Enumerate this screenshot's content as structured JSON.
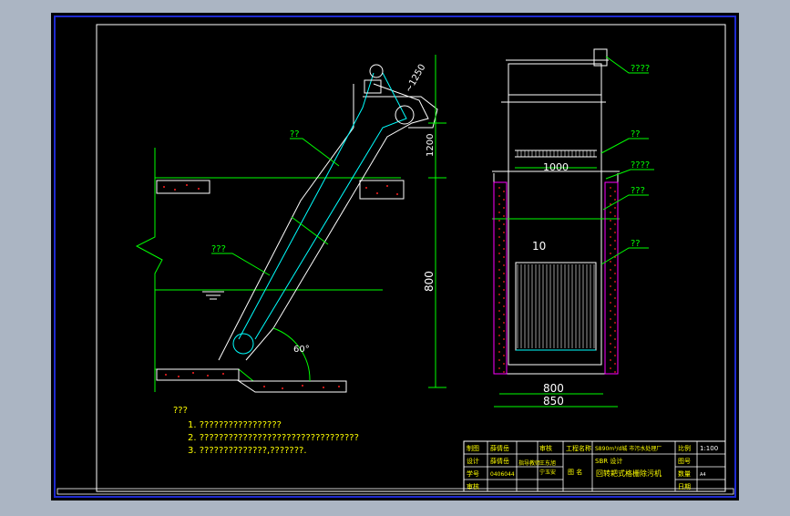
{
  "colors": {
    "background": "#abb5c3",
    "paper": "#000000",
    "line_white": "#ffffff",
    "line_green": "#00ff00",
    "line_cyan": "#00ffff",
    "line_yellow": "#ffff00",
    "line_red": "#ff2020",
    "line_magenta": "#ff00ff",
    "border_blue": "#1e2ad0"
  },
  "dimensions": {
    "d1250": "~1250",
    "d1200": "1200",
    "d800_vertical": "800",
    "d1000": "1000",
    "d10": "10",
    "d800_bottom": "800",
    "d850": "850",
    "angle": "60°"
  },
  "callouts": {
    "c_left_top": "??",
    "c_left_mid": "???",
    "c_right_1": "????",
    "c_right_2": "??",
    "c_right_3": "????",
    "c_right_4": "???",
    "c_right_5": "??"
  },
  "notes": {
    "title": "???",
    "line1": "1. ?????????????????",
    "line2": "2. ?????????????????????????????????",
    "line3": "3. ??????????????,???????."
  },
  "title_block": {
    "r1c1": "制图",
    "r1c2": "薛倩岳",
    "r1c3": "审核",
    "r1c4": "工程名称",
    "r1c5": "S890m³/d城 市污水处理厂",
    "r1c6": "比例",
    "r1c7": "1:100",
    "r2c1": "设计",
    "r2c2": "薛倩岳",
    "r2c3": "指导教师",
    "r2c4": "王东旭",
    "r2c5": "SBR 设计",
    "r2c6": "图号",
    "r3c1": "学号",
    "r3c2": "0406044",
    "r3c3": "",
    "r3c4": "宁玉安",
    "r3c5": "图 名",
    "r3c6": "回转耙式格栅除污机",
    "r3c7": "数量",
    "r3c8": "A4",
    "r4c1": "审核",
    "r4c7": "日期"
  }
}
